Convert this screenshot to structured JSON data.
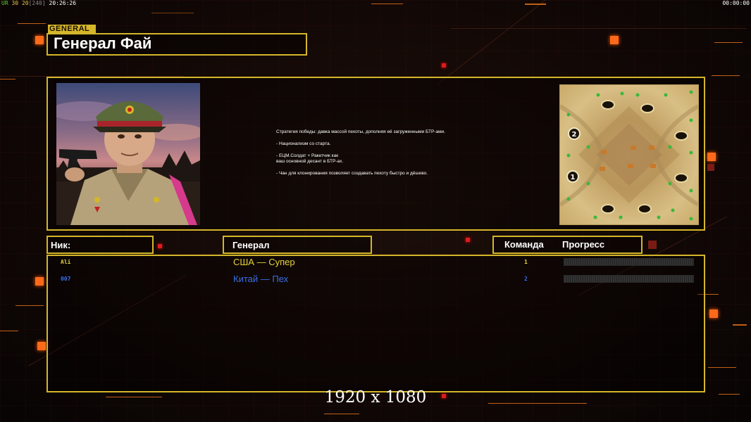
{
  "hud": {
    "left_a": "UR",
    "left_b": "30",
    "left_c": "20",
    "left_d": "[240]",
    "time": "20:26:26",
    "right_time": "00:00:00"
  },
  "general_label": "GENERAL",
  "general_name": "Генерал Фай",
  "strategy": [
    "Стратегия победы: давка массой пехоты, дополняя её загруженными БТР-ами.",
    "- Национализм со старта.",
    "- ЕЦМ.Солдат + Ракетчик как\nваш основной десант в БТР-ах.",
    "- Чан для клонирования позволяет создавать пехоту быстро и дёшево."
  ],
  "columns": {
    "nick": "Ник:",
    "general": "Генерал",
    "team": "Команда",
    "progress": "Прогресс"
  },
  "players": [
    {
      "nick": "Ali",
      "general": "США — Супер",
      "team": "1",
      "color": "#e8d23a"
    },
    {
      "nick": "007",
      "general": "Китай — Пех",
      "team": "2",
      "color": "#3a6fe8"
    }
  ],
  "map_labels": {
    "start_2": "2",
    "start_1": "1"
  },
  "icons": {
    "portrait": "general-portrait",
    "map": "minimap"
  },
  "resolution": "1920 x 1080"
}
